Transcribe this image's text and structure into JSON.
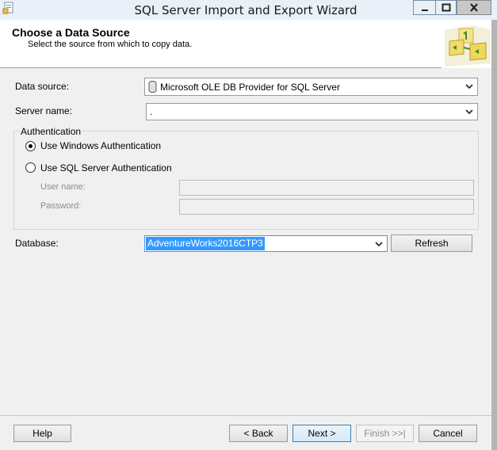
{
  "window": {
    "title": "SQL Server Import and Export Wizard",
    "min_glyph": "—",
    "close_glyph": "✕"
  },
  "header": {
    "title": "Choose a Data Source",
    "subtitle": "Select the source from which to copy data."
  },
  "form": {
    "data_source_label": "Data source:",
    "data_source_value": "Microsoft OLE DB Provider for SQL Server",
    "server_name_label": "Server name:",
    "server_name_value": ".",
    "authentication_label": "Authentication",
    "windows_auth_label": "Use Windows Authentication",
    "sql_auth_label": "Use SQL Server Authentication",
    "selected_auth": "windows",
    "user_name_label": "User name:",
    "user_name_value": "",
    "password_label": "Password:",
    "password_value": "",
    "database_label": "Database:",
    "database_value": "AdventureWorks2016CTP3",
    "refresh_label": "Refresh"
  },
  "footer": {
    "help_label": "Help",
    "back_label": "< Back",
    "next_label": "Next >",
    "finish_label": "Finish >>|",
    "cancel_label": "Cancel"
  },
  "colors": {
    "selection": "#3399ff",
    "titlebar": "#e9f0f7",
    "close_button": "#c7c7c7"
  }
}
